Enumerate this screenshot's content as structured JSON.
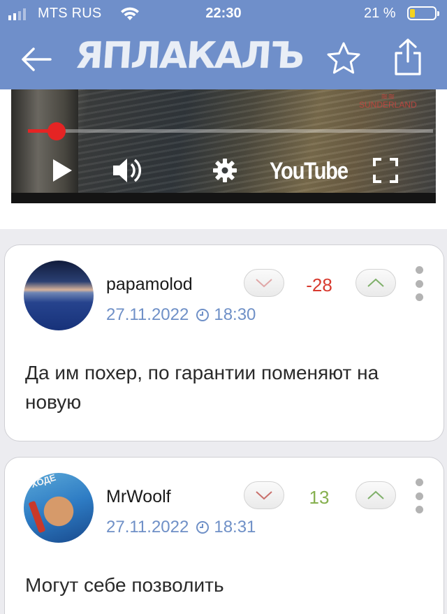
{
  "status_bar": {
    "carrier": "MTS RUS",
    "time": "22:30",
    "battery_percent": "21 %",
    "battery_level": 0.21,
    "signal_bars": 2
  },
  "header": {
    "logo_text": "ЯПЛАКАЛЪ",
    "back_icon": "arrow-left-icon",
    "favorite_icon": "star-outline-icon",
    "share_icon": "share-icon"
  },
  "video": {
    "watermark": "SUNDERLAND",
    "player_brand": "YouTube",
    "progress": 0.07,
    "icons": [
      "play-icon",
      "volume-icon",
      "settings-gear-icon",
      "fullscreen-icon"
    ],
    "accent_color": "#e52424"
  },
  "comments": [
    {
      "username": "papamolod",
      "date": "27.11.2022",
      "time": "18:30",
      "score": "-28",
      "score_color": "#d83a2f",
      "text": "Да им похер, по гарантии поменяют на новую"
    },
    {
      "username": "MrWoolf",
      "date": "27.11.2022",
      "time": "18:31",
      "score": "13",
      "score_color": "#86b04f",
      "text": "Могут себе позволить"
    }
  ],
  "colors": {
    "header_bg": "#6f8fca",
    "date_text": "#6f90c7"
  }
}
